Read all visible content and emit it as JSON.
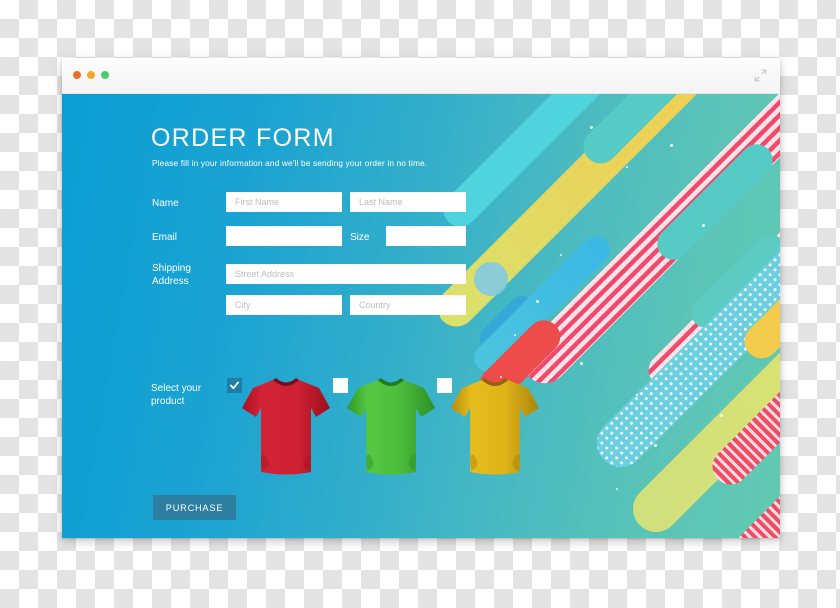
{
  "window": {
    "traffic_lights": [
      {
        "name": "close",
        "color": "#e8702a"
      },
      {
        "name": "minimize",
        "color": "#f0a92e"
      },
      {
        "name": "maximize",
        "color": "#4ecb71"
      }
    ],
    "expand_icon": "expand-arrows-icon"
  },
  "page": {
    "title": "ORDER FORM",
    "subtitle": "Please fill in your information and we'll be sending your order in no time.",
    "background_gradient_from": "#0b9ed4",
    "background_gradient_to": "#62c9b1"
  },
  "form": {
    "rows": [
      {
        "label": "Name",
        "fields": [
          {
            "name": "first-name-input",
            "placeholder": "First Name",
            "value": ""
          },
          {
            "name": "last-name-input",
            "placeholder": "Last Name",
            "value": ""
          }
        ]
      },
      {
        "label": "Email",
        "fields": [
          {
            "name": "email-input",
            "placeholder": "",
            "value": ""
          }
        ],
        "inline_label": "Size",
        "inline_field": {
          "name": "size-input",
          "placeholder": "",
          "value": ""
        }
      },
      {
        "label": "Shipping\nAddress",
        "label_line1": "Shipping",
        "label_line2": "Address",
        "fields": [
          {
            "name": "street-address-input",
            "placeholder": "Street Address",
            "value": ""
          },
          {
            "name": "city-input",
            "placeholder": "City",
            "value": ""
          },
          {
            "name": "country-input",
            "placeholder": "Country",
            "value": ""
          }
        ]
      }
    ],
    "product_section": {
      "label_line1": "Select your",
      "label_line2": "product",
      "products": [
        {
          "name": "tshirt-red",
          "color": "#cf2134",
          "selected": true
        },
        {
          "name": "tshirt-green",
          "color": "#4cbb3c",
          "selected": false
        },
        {
          "name": "tshirt-yellow",
          "color": "#ddb318",
          "selected": false
        }
      ]
    },
    "submit_label": "PURCHASE",
    "submit_color": "#2c7fa0"
  },
  "decoration": {
    "accent_colors": {
      "cyan": "#4fd3dd",
      "teal": "#55c9c4",
      "yellow": "#f3cc4b",
      "lime": "#d8e06b",
      "pink": "#f0496c",
      "red": "#ee4b4b",
      "sky": "#7ec9ea"
    }
  }
}
